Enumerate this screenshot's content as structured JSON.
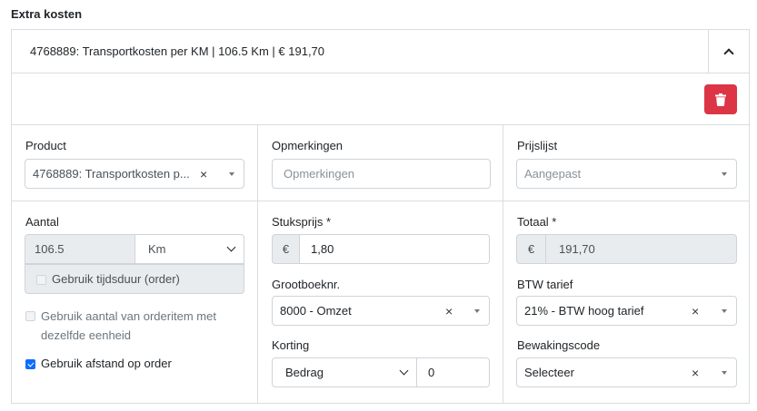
{
  "section": {
    "title": "Extra kosten"
  },
  "item": {
    "header": "4768889: Transportkosten per KM | 106.5 Km | € 191,70"
  },
  "product": {
    "label": "Product",
    "value": "4768889: Transportkosten p...",
    "clear": "×"
  },
  "opmerkingen": {
    "label": "Opmerkingen",
    "placeholder": "Opmerkingen"
  },
  "prijslijst": {
    "label": "Prijslijst",
    "value": "Aangepast"
  },
  "aantal": {
    "label": "Aantal",
    "value": "106.5",
    "unit": "Km",
    "tijdsduur_label": "Gebruik tijdsduur (order)",
    "orderitem_label_line1": "Gebruik aantal van orderitem met",
    "orderitem_label_line2": "dezelfde eenheid",
    "afstand_label": "Gebruik afstand op order",
    "afstand_checked": true
  },
  "stuksprijs": {
    "label": "Stuksprijs *",
    "currency": "€",
    "value": "1,80"
  },
  "grootboek": {
    "label": "Grootboeknr.",
    "value": "8000 - Omzet",
    "clear": "×"
  },
  "korting": {
    "label": "Korting",
    "type": "Bedrag",
    "value": "0"
  },
  "totaal": {
    "label": "Totaal *",
    "currency": "€",
    "value": "191,70"
  },
  "btw": {
    "label": "BTW tarief",
    "value": "21% - BTW hoog tarief",
    "clear": "×"
  },
  "bewaking": {
    "label": "Bewakingscode",
    "value": "Selecteer",
    "clear": "×"
  },
  "colors": {
    "danger": "#dc3545",
    "primary": "#0d6efd",
    "border": "#d9dde1",
    "disabled_bg": "#e9ecef"
  }
}
